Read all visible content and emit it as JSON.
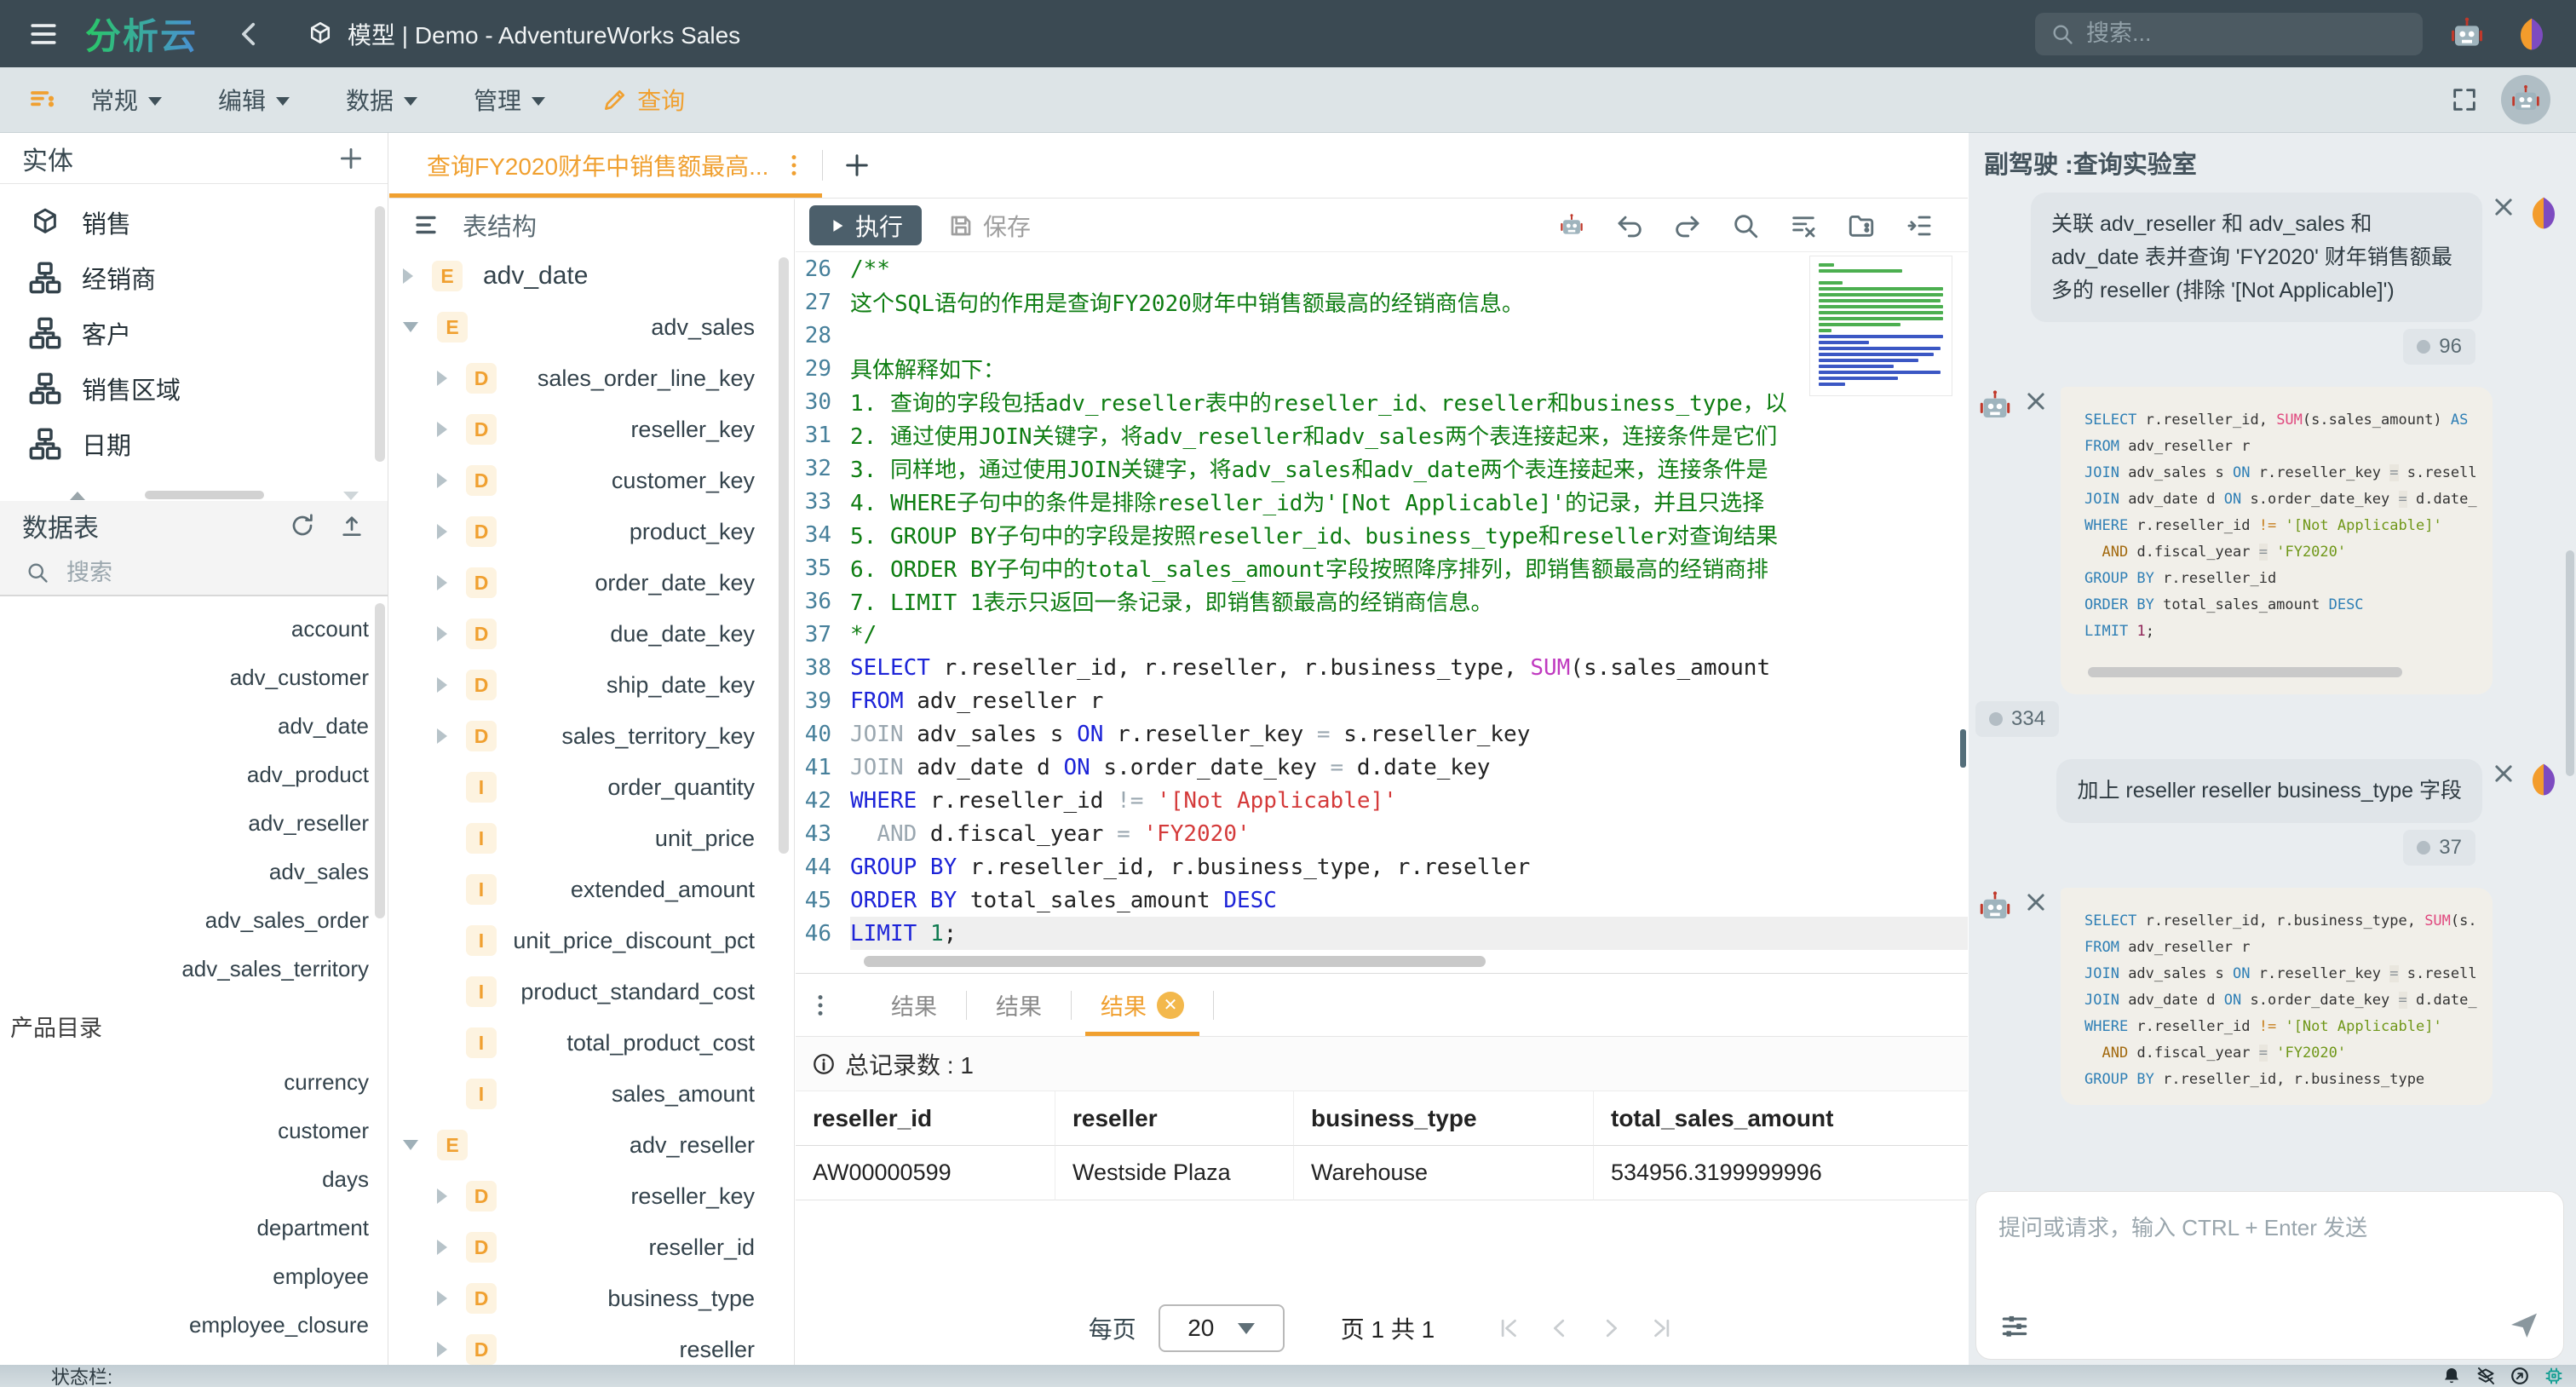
{
  "app": {
    "logo": "分析云",
    "breadcrumb": "模型 | Demo - AdventureWorks Sales",
    "search_placeholder": "搜索...",
    "status_label": "状态栏:"
  },
  "menu": {
    "items": [
      {
        "label": "常规"
      },
      {
        "label": "编辑"
      },
      {
        "label": "数据"
      },
      {
        "label": "管理"
      }
    ],
    "active": "查询"
  },
  "sidebar": {
    "entities": {
      "title": "实体",
      "items": [
        {
          "icon": "cube",
          "label": "销售"
        },
        {
          "icon": "org",
          "label": "经销商"
        },
        {
          "icon": "org",
          "label": "客户"
        },
        {
          "icon": "org",
          "label": "销售区域"
        },
        {
          "icon": "org",
          "label": "日期"
        }
      ]
    },
    "tables": {
      "title": "数据表",
      "search_placeholder": "搜索",
      "primary": [
        "account",
        "adv_customer",
        "adv_date",
        "adv_product",
        "adv_reseller",
        "adv_sales",
        "adv_sales_order",
        "adv_sales_territory"
      ],
      "catalog_label": "产品目录",
      "catalog": [
        "currency",
        "customer",
        "days",
        "department",
        "employee",
        "employee_closure"
      ]
    }
  },
  "workspace": {
    "tab": {
      "title": "查询FY2020财年中销售额最高..."
    },
    "tree": {
      "title": "表结构",
      "items": [
        {
          "a": "r",
          "b": "E",
          "t": "adv_date",
          "lv": 0,
          "left": true
        },
        {
          "a": "d",
          "b": "E",
          "t": "adv_sales",
          "lv": 0
        },
        {
          "a": "r",
          "b": "D",
          "t": "sales_order_line_key",
          "lv": 1
        },
        {
          "a": "r",
          "b": "D",
          "t": "reseller_key",
          "lv": 1
        },
        {
          "a": "r",
          "b": "D",
          "t": "customer_key",
          "lv": 1
        },
        {
          "a": "r",
          "b": "D",
          "t": "product_key",
          "lv": 1
        },
        {
          "a": "r",
          "b": "D",
          "t": "order_date_key",
          "lv": 1
        },
        {
          "a": "r",
          "b": "D",
          "t": "due_date_key",
          "lv": 1
        },
        {
          "a": "r",
          "b": "D",
          "t": "ship_date_key",
          "lv": 1
        },
        {
          "a": "r",
          "b": "D",
          "t": "sales_territory_key",
          "lv": 1
        },
        {
          "a": "n",
          "b": "I",
          "t": "order_quantity",
          "lv": 1
        },
        {
          "a": "n",
          "b": "I",
          "t": "unit_price",
          "lv": 1
        },
        {
          "a": "n",
          "b": "I",
          "t": "extended_amount",
          "lv": 1
        },
        {
          "a": "n",
          "b": "I",
          "t": "unit_price_discount_pct",
          "lv": 1
        },
        {
          "a": "n",
          "b": "I",
          "t": "product_standard_cost",
          "lv": 1
        },
        {
          "a": "n",
          "b": "I",
          "t": "total_product_cost",
          "lv": 1
        },
        {
          "a": "n",
          "b": "I",
          "t": "sales_amount",
          "lv": 1
        },
        {
          "a": "d",
          "b": "E",
          "t": "adv_reseller",
          "lv": 0
        },
        {
          "a": "r",
          "b": "D",
          "t": "reseller_key",
          "lv": 1
        },
        {
          "a": "r",
          "b": "D",
          "t": "reseller_id",
          "lv": 1
        },
        {
          "a": "r",
          "b": "D",
          "t": "business_type",
          "lv": 1
        },
        {
          "a": "r",
          "b": "D",
          "t": "reseller",
          "lv": 1
        }
      ]
    },
    "toolbar": {
      "run": "执行",
      "save": "保存"
    },
    "editor": {
      "lines": [
        {
          "n": 26,
          "seg": [
            [
              "c",
              "/**"
            ]
          ]
        },
        {
          "n": 27,
          "seg": [
            [
              "c",
              "这个SQL语句的作用是查询FY2020财年中销售额最高的经销商信息。"
            ]
          ]
        },
        {
          "n": 28,
          "seg": []
        },
        {
          "n": 29,
          "seg": [
            [
              "c",
              "具体解释如下："
            ]
          ]
        },
        {
          "n": 30,
          "seg": [
            [
              "c",
              "1. 查询的字段包括adv_reseller表中的reseller_id、reseller和business_type，以"
            ]
          ]
        },
        {
          "n": 31,
          "seg": [
            [
              "c",
              "2. 通过使用JOIN关键字，将adv_reseller和adv_sales两个表连接起来，连接条件是它们"
            ]
          ]
        },
        {
          "n": 32,
          "seg": [
            [
              "c",
              "3. 同样地，通过使用JOIN关键字，将adv_sales和adv_date两个表连接起来，连接条件是"
            ]
          ]
        },
        {
          "n": 33,
          "seg": [
            [
              "c",
              "4. WHERE子句中的条件是排除reseller_id为'[Not Applicable]'的记录，并且只选择"
            ]
          ]
        },
        {
          "n": 34,
          "seg": [
            [
              "c",
              "5. GROUP BY子句中的字段是按照reseller_id、business_type和reseller对查询结果"
            ]
          ]
        },
        {
          "n": 35,
          "seg": [
            [
              "c",
              "6. ORDER BY子句中的total_sales_amount字段按照降序排列，即销售额最高的经销商排"
            ]
          ]
        },
        {
          "n": 36,
          "seg": [
            [
              "c",
              "7. LIMIT 1表示只返回一条记录，即销售额最高的经销商信息。"
            ]
          ]
        },
        {
          "n": 37,
          "seg": [
            [
              "c",
              "*/"
            ]
          ]
        },
        {
          "n": 38,
          "seg": [
            [
              "k",
              "SELECT"
            ],
            [
              "t",
              " r.reseller_id, r.reseller, r.business_type, "
            ],
            [
              "f",
              "SUM"
            ],
            [
              "t",
              "(s.sales_amount"
            ]
          ]
        },
        {
          "n": 39,
          "seg": [
            [
              "k",
              "FROM"
            ],
            [
              "t",
              " adv_reseller r"
            ]
          ]
        },
        {
          "n": 40,
          "seg": [
            [
              "o",
              "JOIN"
            ],
            [
              "t",
              " adv_sales s "
            ],
            [
              "k",
              "ON"
            ],
            [
              "t",
              " r.reseller_key "
            ],
            [
              "o",
              "="
            ],
            [
              "t",
              " s.reseller_key"
            ]
          ]
        },
        {
          "n": 41,
          "seg": [
            [
              "o",
              "JOIN"
            ],
            [
              "t",
              " adv_date d "
            ],
            [
              "k",
              "ON"
            ],
            [
              "t",
              " s.order_date_key "
            ],
            [
              "o",
              "="
            ],
            [
              "t",
              " d.date_key"
            ]
          ]
        },
        {
          "n": 42,
          "seg": [
            [
              "k",
              "WHERE"
            ],
            [
              "t",
              " r.reseller_id "
            ],
            [
              "o",
              "!="
            ],
            [
              "t",
              " "
            ],
            [
              "s",
              "'[Not Applicable]'"
            ]
          ]
        },
        {
          "n": 43,
          "seg": [
            [
              "t",
              "  "
            ],
            [
              "o",
              "AND"
            ],
            [
              "t",
              " d.fiscal_year "
            ],
            [
              "o",
              "="
            ],
            [
              "t",
              " "
            ],
            [
              "s",
              "'FY2020'"
            ]
          ]
        },
        {
          "n": 44,
          "seg": [
            [
              "k",
              "GROUP BY"
            ],
            [
              "t",
              " r.reseller_id, r.business_type, r.reseller"
            ]
          ]
        },
        {
          "n": 45,
          "seg": [
            [
              "k",
              "ORDER BY"
            ],
            [
              "t",
              " total_sales_amount "
            ],
            [
              "k",
              "DESC"
            ]
          ]
        },
        {
          "n": 46,
          "seg": [
            [
              "k",
              "LIMIT"
            ],
            [
              "t",
              " "
            ],
            [
              "n2",
              "1"
            ],
            [
              "t",
              ";"
            ]
          ],
          "cur": true
        }
      ]
    },
    "results": {
      "tabs": [
        "结果",
        "结果",
        "结果"
      ],
      "active_tab": 2,
      "total": "总记录数 : 1",
      "columns": [
        "reseller_id",
        "reseller",
        "business_type",
        "total_sales_amount"
      ],
      "rows": [
        [
          "AW00000599",
          "Westside Plaza",
          "Warehouse",
          "534956.3199999996"
        ]
      ],
      "pagination": {
        "per_page_label": "每页",
        "per_page": "20",
        "page_info": "页 1 共 1"
      }
    }
  },
  "copilot": {
    "title": "副驾驶 :查询实验室",
    "messages": [
      {
        "role": "user",
        "text": "关联 adv_reseller 和 adv_sales 和 adv_date 表并查询 'FY2020' 财年销售额最多的 reseller (排除 '[Not Applicable]')",
        "tokens": "96"
      },
      {
        "role": "assistant",
        "tokens": "334",
        "scrollbar": true,
        "sql": [
          [
            [
              "k",
              "SELECT"
            ],
            [
              "t",
              " r.reseller_id, "
            ],
            [
              "f",
              "SUM"
            ],
            [
              "t",
              "(s.sales_amount) "
            ],
            [
              "k",
              "AS"
            ]
          ],
          [
            [
              "k",
              "FROM"
            ],
            [
              "t",
              " adv_reseller r"
            ]
          ],
          [
            [
              "k",
              "JOIN"
            ],
            [
              "t",
              " adv_sales s "
            ],
            [
              "k",
              "ON"
            ],
            [
              "t",
              " r.reseller_key "
            ],
            [
              "g",
              "="
            ],
            [
              "t",
              " s.resell"
            ]
          ],
          [
            [
              "k",
              "JOIN"
            ],
            [
              "t",
              " adv_date d "
            ],
            [
              "k",
              "ON"
            ],
            [
              "t",
              " s.order_date_key "
            ],
            [
              "g",
              "="
            ],
            [
              "t",
              " d.date_"
            ]
          ],
          [
            [
              "k",
              "WHERE"
            ],
            [
              "t",
              " r.reseller_id "
            ],
            [
              "q",
              "!="
            ],
            [
              "t",
              " "
            ],
            [
              "s",
              "'[Not Applicable]'"
            ]
          ],
          [
            [
              "t",
              "  "
            ],
            [
              "o",
              "AND"
            ],
            [
              "t",
              " d.fiscal_year "
            ],
            [
              "g",
              "="
            ],
            [
              "t",
              " "
            ],
            [
              "s",
              "'FY2020'"
            ]
          ],
          [
            [
              "k",
              "GROUP BY"
            ],
            [
              "t",
              " r.reseller_id"
            ]
          ],
          [
            [
              "k",
              "ORDER BY"
            ],
            [
              "t",
              " total_sales_amount "
            ],
            [
              "k",
              "DESC"
            ]
          ],
          [
            [
              "k",
              "LIMIT"
            ],
            [
              "t",
              " "
            ],
            [
              "n2",
              "1"
            ],
            [
              "t",
              ";"
            ]
          ]
        ]
      },
      {
        "role": "user",
        "text": "加上 reseller reseller business_type 字段",
        "tokens": "37"
      },
      {
        "role": "assistant",
        "sql": [
          [
            [
              "k",
              "SELECT"
            ],
            [
              "t",
              " r.reseller_id, r.business_type, "
            ],
            [
              "f",
              "SUM"
            ],
            [
              "t",
              "(s."
            ]
          ],
          [
            [
              "k",
              "FROM"
            ],
            [
              "t",
              " adv_reseller r"
            ]
          ],
          [
            [
              "k",
              "JOIN"
            ],
            [
              "t",
              " adv_sales s "
            ],
            [
              "k",
              "ON"
            ],
            [
              "t",
              " r.reseller_key "
            ],
            [
              "g",
              "="
            ],
            [
              "t",
              " s.resell"
            ]
          ],
          [
            [
              "k",
              "JOIN"
            ],
            [
              "t",
              " adv_date d "
            ],
            [
              "k",
              "ON"
            ],
            [
              "t",
              " s.order_date_key "
            ],
            [
              "g",
              "="
            ],
            [
              "t",
              " d.date_"
            ]
          ],
          [
            [
              "k",
              "WHERE"
            ],
            [
              "t",
              " r.reseller_id "
            ],
            [
              "q",
              "!="
            ],
            [
              "t",
              " "
            ],
            [
              "s",
              "'[Not Applicable]'"
            ]
          ],
          [
            [
              "t",
              "  "
            ],
            [
              "o",
              "AND"
            ],
            [
              "t",
              " d.fiscal_year "
            ],
            [
              "g",
              "="
            ],
            [
              "t",
              " "
            ],
            [
              "s",
              "'FY2020'"
            ]
          ],
          [
            [
              "k",
              "GROUP BY"
            ],
            [
              "t",
              " r.reseller_id, r.business_type"
            ]
          ]
        ]
      }
    ],
    "input_placeholder": "提问或请求，输入 CTRL + Enter 发送"
  }
}
